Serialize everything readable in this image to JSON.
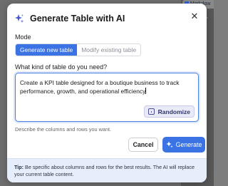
{
  "background": {
    "tab_label": "Markdow"
  },
  "dialog": {
    "title": "Generate Table with AI",
    "mode": {
      "label": "Mode",
      "options": [
        "Generate new table",
        "Modify existing table"
      ],
      "selected": "Generate new table"
    },
    "prompt": {
      "question": "What kind of table do you need?",
      "value": "Create a KPI table designed for a boutique business to track performance, growth, and operational efficiency",
      "hint": "Describe the columns and rows you want.",
      "randomize_label": "Randomize"
    },
    "buttons": {
      "cancel": "Cancel",
      "generate": "Generate"
    },
    "tip": {
      "label": "Tip:",
      "text": "Be specific about columns and rows for the best results. The AI will replace your current table content."
    }
  },
  "colors": {
    "accent": "#3b73e5",
    "tip_background": "#e7eefb",
    "overlay": "#6e6e6e"
  }
}
